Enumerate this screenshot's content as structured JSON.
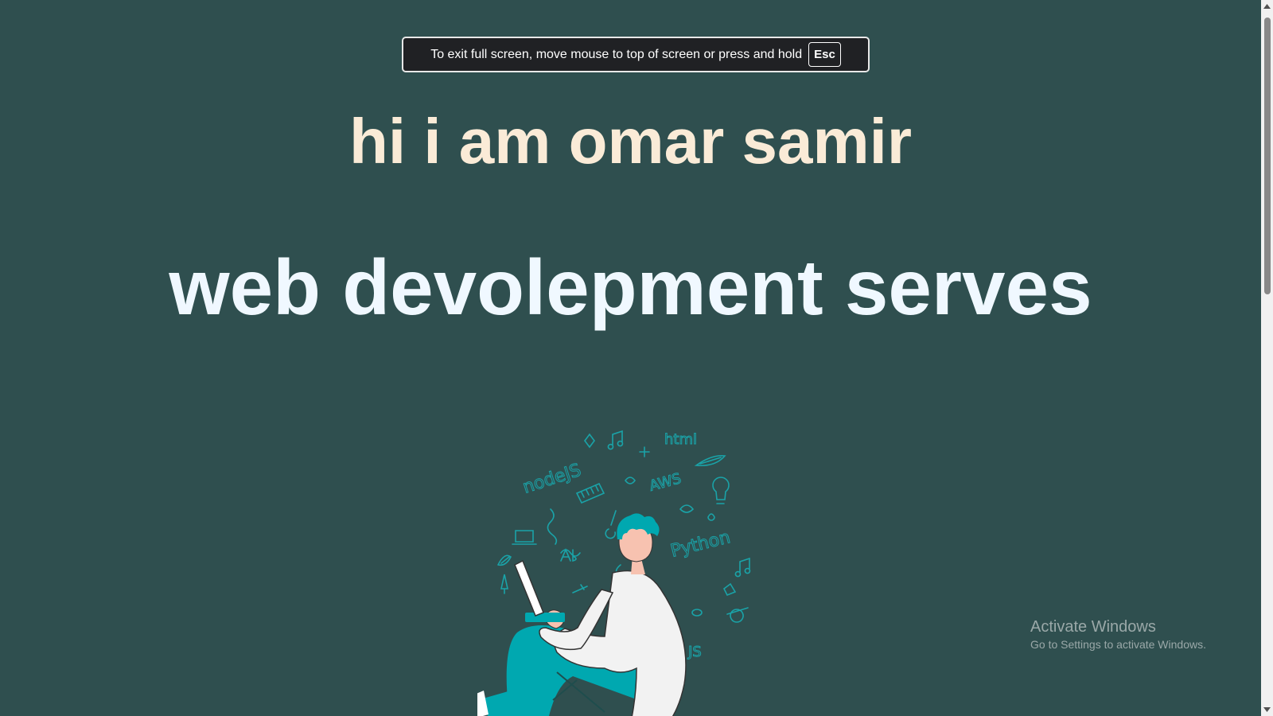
{
  "fullscreen_notice": {
    "message": "To exit full screen, move mouse to top of screen or press and hold",
    "key": "Esc"
  },
  "hero": {
    "name_line": "hi i am omar samir",
    "service_line": "web devolepment serves"
  },
  "illustration": {
    "icon": "developer-with-laptop-illustration",
    "doodles": [
      "nodeJS",
      "html",
      "AWS",
      "Python",
      "JS"
    ]
  },
  "watermark": {
    "title": "Activate Windows",
    "subtitle": "Go to Settings to activate Windows."
  },
  "colors": {
    "background": "#2f4f4f",
    "name_color": "#faebd7",
    "service_color": "#f0f8ff",
    "accent_teal": "#00a8b0",
    "doodle_color": "#1aa3a8"
  }
}
